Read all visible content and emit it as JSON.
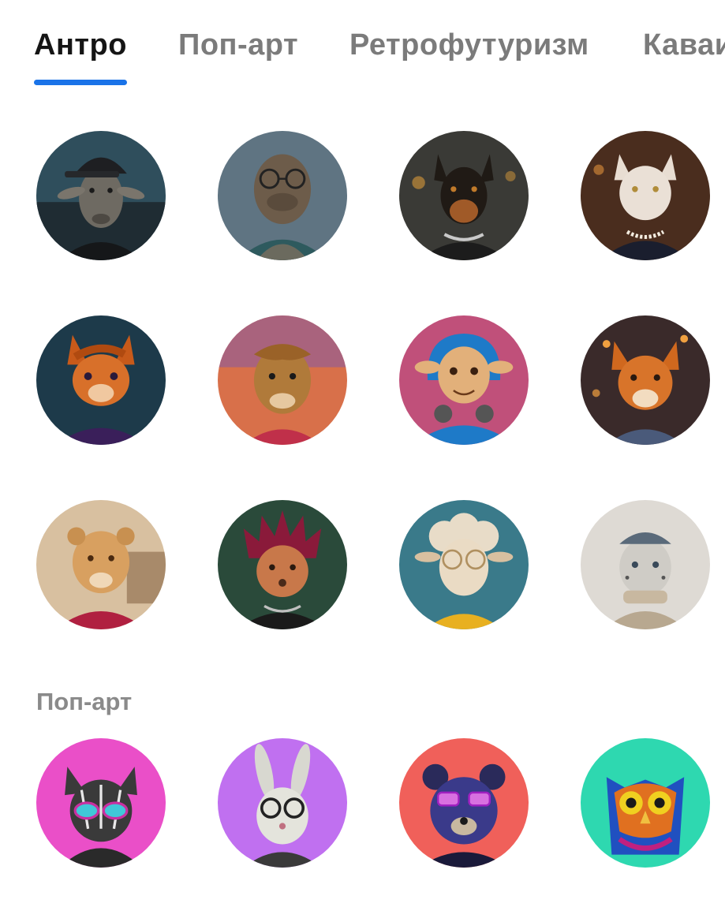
{
  "tabs": [
    {
      "label": "Антро",
      "active": true
    },
    {
      "label": "Поп-арт",
      "active": false
    },
    {
      "label": "Ретрофутуризм",
      "active": false
    },
    {
      "label": "Каваи",
      "active": false
    }
  ],
  "sections": [
    {
      "title": "",
      "avatars": [
        {
          "subject": "goat-in-cap"
        },
        {
          "subject": "walrus-with-glasses"
        },
        {
          "subject": "doberman-with-chain"
        },
        {
          "subject": "white-cat-with-pearls"
        },
        {
          "subject": "squirrel-in-hoodie"
        },
        {
          "subject": "llama-at-sunset"
        },
        {
          "subject": "kangaroo-with-headphones"
        },
        {
          "subject": "fox-in-jacket"
        },
        {
          "subject": "lioness-in-red-blazer"
        },
        {
          "subject": "hedgehog-punk"
        },
        {
          "subject": "sheep-with-glasses"
        },
        {
          "subject": "snow-leopard-in-beanie"
        }
      ]
    },
    {
      "title": "Поп-арт",
      "avatars": [
        {
          "subject": "pop-art-cat-with-sunglasses"
        },
        {
          "subject": "pop-art-rabbit-with-glasses"
        },
        {
          "subject": "pop-art-bear-with-glasses"
        },
        {
          "subject": "pop-art-owl"
        }
      ]
    }
  ],
  "colors": {
    "active_tab_text": "#151515",
    "inactive_tab_text": "#7b7b7b",
    "tab_indicator": "#1a73e8",
    "section_title": "#8a8a8a"
  }
}
